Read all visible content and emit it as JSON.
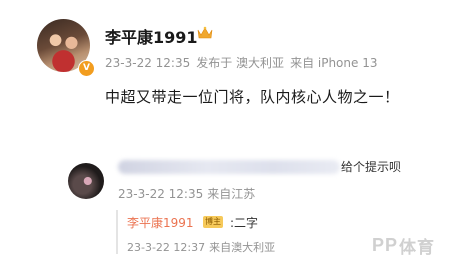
{
  "post": {
    "author": "李平康1991",
    "verified_badge": "V",
    "crown_icon": "crown-icon",
    "date": "23-3-22 12:35",
    "location": "发布于 澳大利亚",
    "device": "来自 iPhone 13",
    "text": "中超又带走一位门将，队内核心人物之一！"
  },
  "reply": {
    "text_tail": "给个提示呗",
    "date": "23-3-22 12:35",
    "source": "来自江苏"
  },
  "nested_reply": {
    "author": "李平康1991",
    "badge": "博主",
    "text": ":二字",
    "date": "23-3-22 12:37",
    "source": "来自澳大利亚"
  },
  "watermark": {
    "logo": "PP",
    "text": "体育"
  },
  "colors": {
    "author_link": "#eb7350",
    "meta_gray": "#939393",
    "badge_orange": "#f29d1f"
  }
}
